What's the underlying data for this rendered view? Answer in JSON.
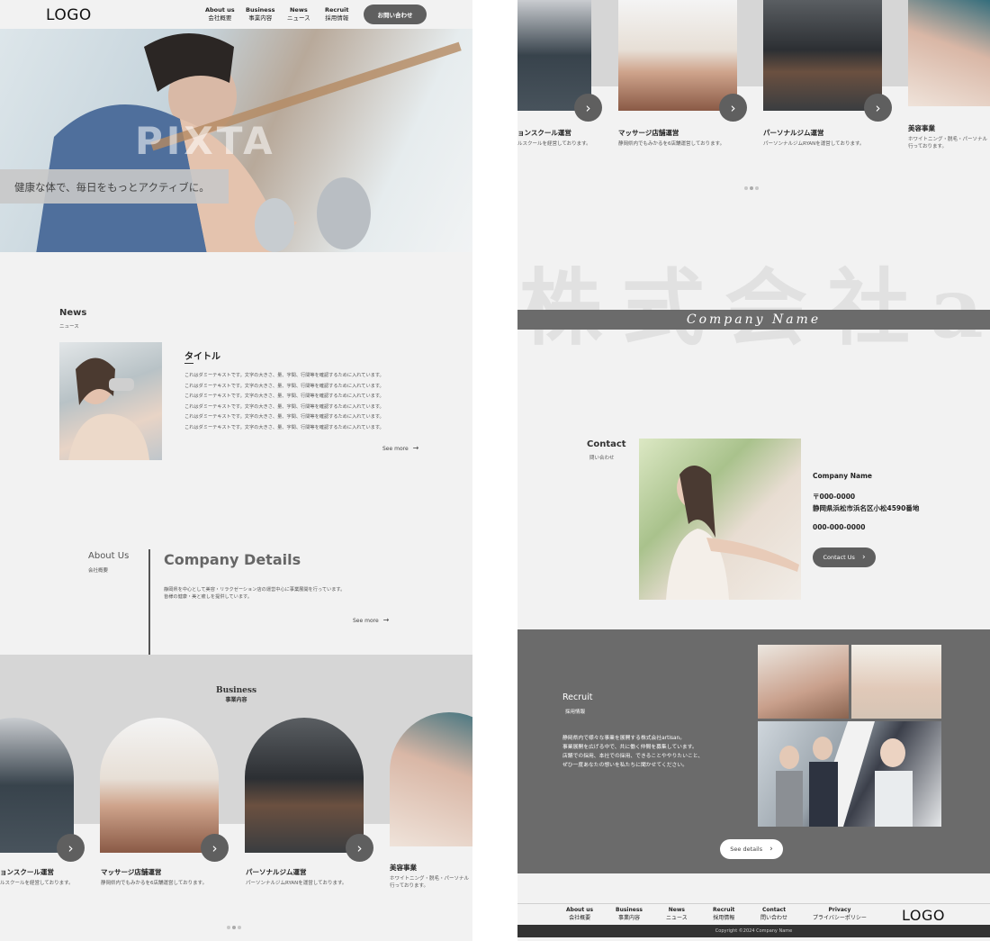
{
  "header": {
    "logo": "LOGO",
    "nav": [
      {
        "en": "About us",
        "ja": "会社概要"
      },
      {
        "en": "Business",
        "ja": "事業内容"
      },
      {
        "en": "News",
        "ja": "ニュース"
      },
      {
        "en": "Recruit",
        "ja": "採用情報"
      }
    ],
    "contact_button": "お問い合わせ"
  },
  "hero": {
    "watermark": "PIXTA",
    "catch_copy": "健康な体で、毎日をもっとアクティブに。"
  },
  "news": {
    "title_en": "News",
    "title_ja": "ニュース",
    "article_title": "タイトル",
    "body_lines": [
      "これはダミーテキストです。文字の大きさ、量、字間、行間等を確認するために入れています。",
      "これはダミーテキストです。文字の大きさ、量、字間、行間等を確認するために入れています。",
      "これはダミーテキストです。文字の大きさ、量、字間、行間等を確認するために入れています。",
      "これはダミーテキストです。文字の大きさ、量、字間、行間等を確認するために入れています。",
      "これはダミーテキストです。文字の大きさ、量、字間、行間等を確認するために入れています。",
      "これはダミーテキストです。文字の大きさ、量、字間、行間等を確認するために入れています。"
    ],
    "see_more": "See more"
  },
  "about": {
    "title_en": "About Us",
    "title_ja": "会社概要",
    "heading": "Company Details",
    "body_lines": [
      "静岡県を中心として美容・リラクゼーション店の運営中心に事業展開を行っています。",
      "皆様の健康・美と癒しを提供しています。"
    ],
    "see_more": "See more"
  },
  "business": {
    "title_en": "Business",
    "title_ja": "事業内容",
    "cards_left": [
      {
        "title": "ョンスクール運営",
        "desc": "ルスクールを経営しております。"
      },
      {
        "title": "マッサージ店舗運営",
        "desc": "静岡県内でもみかるを6店舗運営しております。"
      },
      {
        "title": "パーソナルジム運営",
        "desc": "パーソンナルジムRYANを運営しております。"
      },
      {
        "title": "美容事業",
        "desc": "ホワイトニング・脱毛・パーソナル",
        "desc2": "行っております。"
      }
    ],
    "cards_right": [
      {
        "title": "ョンスクール運営",
        "desc": "ルスクールを経営しております。"
      },
      {
        "title": "マッサージ店舗運営",
        "desc": "静岡県内でもみかるを6店舗運営しております。"
      },
      {
        "title": "パーソナルジム運営",
        "desc": "パーソンナルジムRYANを運営しております。"
      },
      {
        "title": "美容事業",
        "desc": "ホワイトニング・脱毛・パーソナル",
        "desc2": "行っております。"
      }
    ]
  },
  "company_band": {
    "watermark": "株式会社a",
    "name": "Company Name"
  },
  "contact": {
    "title_en": "Contact",
    "title_ja": "問い合わせ",
    "company": "Company Name",
    "zip": "〒000-0000",
    "address": "静岡県浜松市浜名区小松4590番地",
    "phone": "000-000-0000",
    "button": "Contact Us"
  },
  "recruit": {
    "title_en": "Recruit",
    "title_ja": "採用情報",
    "body_lines": [
      "静岡県内で様々な事業を展開する株式会社artisan。",
      "事業展開を広げる中で、共に働く仲間を募集しています。",
      "店舗での採用、本社での採用、できることややりたいこと、",
      "ぜひ一度あなたの想いを私たちに聞かせてください。"
    ],
    "button": "See details"
  },
  "footer": {
    "nav": [
      {
        "en": "About us",
        "ja": "会社概要"
      },
      {
        "en": "Business",
        "ja": "事業内容"
      },
      {
        "en": "News",
        "ja": "ニュース"
      },
      {
        "en": "Recruit",
        "ja": "採用情報"
      },
      {
        "en": "Contact",
        "ja": "問い合わせ"
      },
      {
        "en": "Privacy",
        "ja": "プライバシーポリシー"
      }
    ],
    "logo": "LOGO",
    "copyright": "Copyright ©2024 Company Name"
  },
  "icons": {
    "arrow_right": "arrow-right-icon",
    "chevron_right": "chevron-right-icon"
  },
  "colors": {
    "page_bg": "#f2f2f2",
    "dark_gray": "#6b6b6b",
    "button_gray": "#5f5f5f",
    "band_gray": "#d9d9d9",
    "footer_bar": "#333333"
  }
}
